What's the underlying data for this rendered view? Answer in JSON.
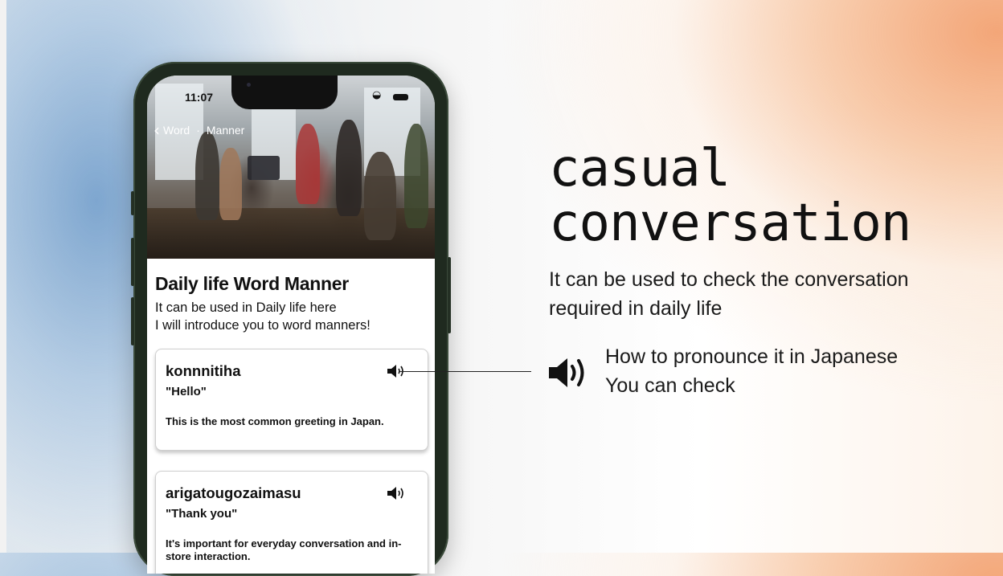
{
  "phone": {
    "status_time": "11:07",
    "nav": {
      "back": "Word",
      "separator": "·",
      "current": "Manner"
    },
    "page_title": "Daily life Word Manner",
    "page_desc": [
      "It can be used in Daily life here",
      "I will introduce you to word manners!"
    ],
    "cards": [
      {
        "word": "konnnitiha",
        "meaning": "\"Hello\"",
        "description": "This is the most common greeting in Japan."
      },
      {
        "word": "arigatougozaimasu",
        "meaning": "\"Thank you\"",
        "description": "It's important for everyday conversation and in-store interaction."
      }
    ]
  },
  "promo": {
    "headline": [
      "casual",
      "conversation"
    ],
    "subtitle": [
      "It can be used to check the conversation",
      "required in daily life"
    ],
    "pronounce": [
      "How to pronounce it in Japanese",
      "You can check"
    ]
  },
  "icons": {
    "speaker": "speaker-icon",
    "back": "chevron-left-icon",
    "wifi": "wifi-icon",
    "battery": "battery-icon"
  },
  "colors": {
    "accent_orange": "#f3a678",
    "accent_blue": "#7ea6cf",
    "phone_frame": "#1f2a1f"
  }
}
